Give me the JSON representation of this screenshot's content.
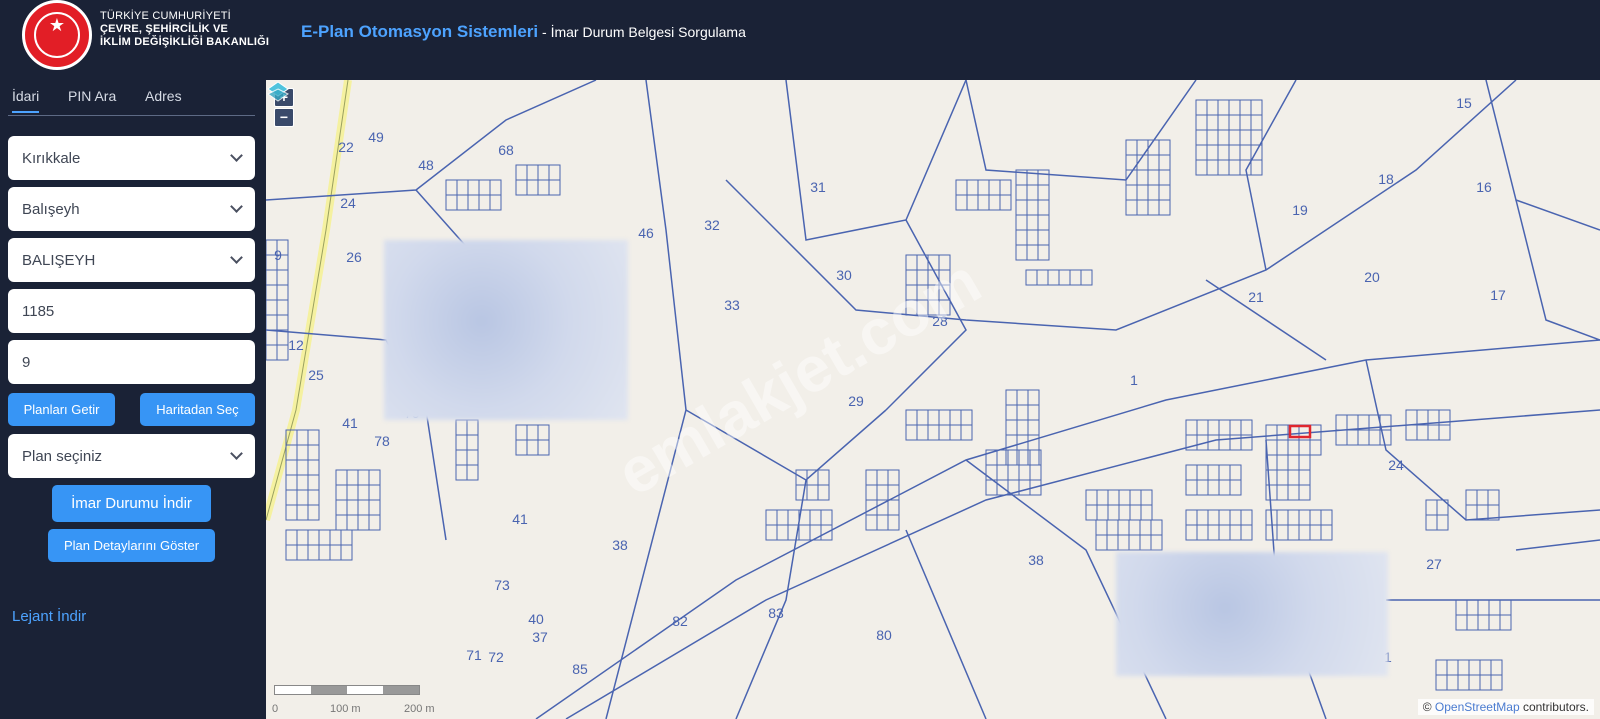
{
  "header": {
    "ministry_line1": "TÜRKİYE CUMHURİYETİ",
    "ministry_line2": "ÇEVRE, ŞEHİRCİLİK VE",
    "ministry_line3": "İKLİM DEĞİŞİKLİĞİ BAKANLIĞI",
    "app_brand": "E-Plan Otomasyon Sistemleri",
    "app_subtitle": " - İmar Durum Belgesi Sorgulama"
  },
  "tabs": [
    {
      "label": "İdari",
      "active": true
    },
    {
      "label": "PIN Ara",
      "active": false
    },
    {
      "label": "Adres",
      "active": false
    }
  ],
  "form": {
    "province": "Kırıkkale",
    "district": "Balışeyh",
    "neighborhood": "BALIŞEYH",
    "block": "1185",
    "parcel": "9",
    "get_plans_label": "Planları Getir",
    "select_from_map_label": "Haritadan Seç",
    "plan_select": "Plan seçiniz",
    "download_zoning_label": "İmar Durumu İndir",
    "show_plan_details_label": "Plan Detaylarını Göster"
  },
  "lejant_label": "Lejant İndir",
  "map": {
    "zoom_in": "+",
    "zoom_out": "−",
    "scale_0": "0",
    "scale_100": "100 m",
    "scale_200": "200 m",
    "attribution_prefix": "© ",
    "attribution_link": "OpenStreetMap",
    "attribution_suffix": " contributors.",
    "watermark": "emlakjet.com",
    "parcel_labels": [
      "49",
      "48",
      "68",
      "22",
      "24",
      "26",
      "46",
      "32",
      "31",
      "33",
      "30",
      "29",
      "28",
      "1",
      "15",
      "16",
      "18",
      "19",
      "20",
      "21",
      "17",
      "24",
      "27",
      "31",
      "38",
      "41",
      "73",
      "72",
      "71",
      "40",
      "37",
      "85",
      "82",
      "83",
      "80",
      "38",
      "41",
      "78",
      "79",
      "36",
      "25",
      "12",
      "9"
    ],
    "parcel_color": "#4a64b0",
    "selected_parcel_color": "#e0262e"
  }
}
